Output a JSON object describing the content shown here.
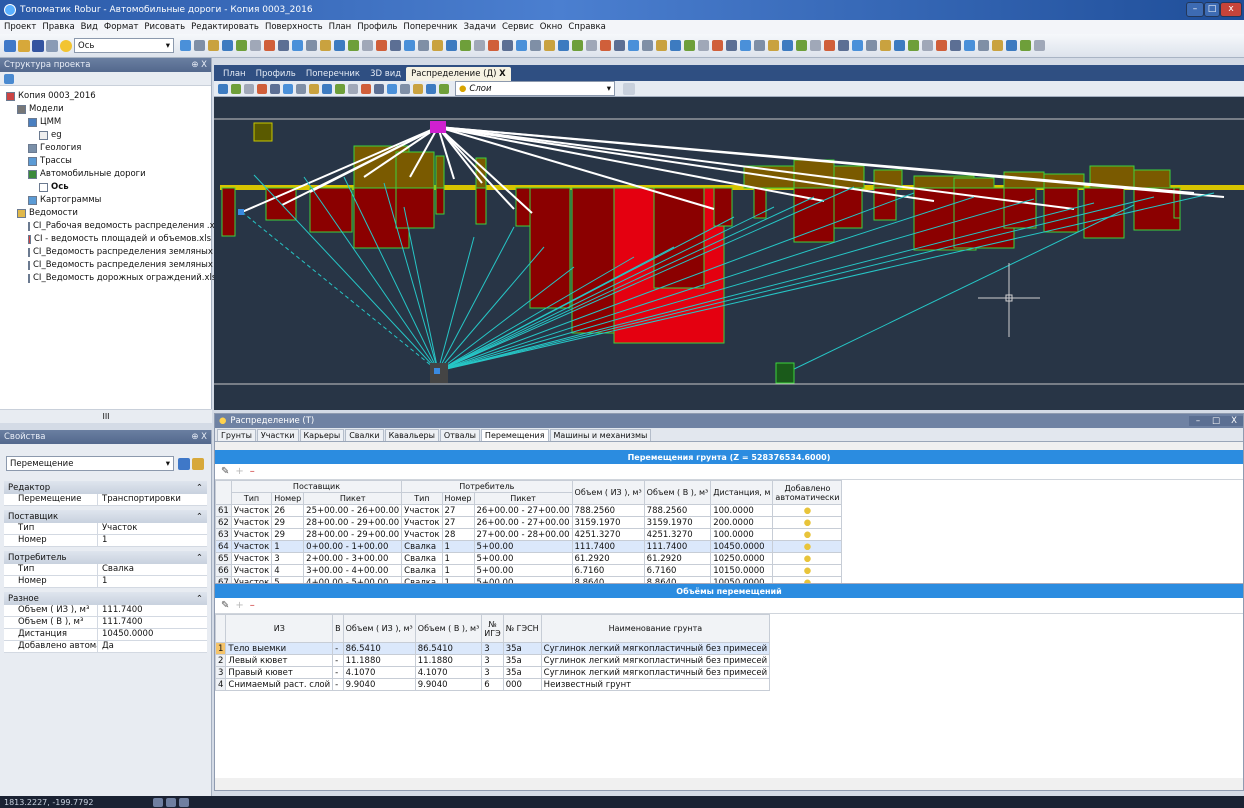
{
  "app": {
    "title": "Топоматик Robur - Автомобильные дороги - Копия 0003_2016",
    "status_coords": "1813.2227, -199.7792"
  },
  "menu": [
    "Проект",
    "Правка",
    "Вид",
    "Формат",
    "Рисовать",
    "Редактировать",
    "Поверхность",
    "План",
    "Профиль",
    "Поперечник",
    "Задачи",
    "Сервис",
    "Окно",
    "Справка"
  ],
  "toolbar": {
    "combo_value": "Ось",
    "cad_combo_value": "Слои"
  },
  "structure": {
    "header": "Структура проекта",
    "items": [
      {
        "label": "Копия 0003_2016",
        "level": 0
      },
      {
        "label": "Модели",
        "level": 1
      },
      {
        "label": "ЦММ",
        "level": 2
      },
      {
        "label": "eg",
        "level": 3
      },
      {
        "label": "Геология",
        "level": 2
      },
      {
        "label": "Трассы",
        "level": 2
      },
      {
        "label": "Автомобильные дороги",
        "level": 2
      },
      {
        "label": "Ось",
        "level": 3
      },
      {
        "label": "Картограммы",
        "level": 2
      },
      {
        "label": "Ведомости",
        "level": 1
      },
      {
        "label": "CI_Рабочая ведомость распределения .xls",
        "level": 2
      },
      {
        "label": "CI - ведомость площадей и объемов.xls",
        "level": 2
      },
      {
        "label": "CI_Ведомость распределения земляных м",
        "level": 2
      },
      {
        "label": "CI_Ведомость распределения земляных м",
        "level": 2
      },
      {
        "label": "CI_Ведомость дорожных ограждений.xls",
        "level": 2
      }
    ],
    "scroll_label": "III"
  },
  "properties": {
    "header": "Свойства",
    "selector": "Перемещение",
    "groups": [
      {
        "title": "Редактор",
        "rows": [
          {
            "k": "Перемещение",
            "v": "Транспортировки"
          }
        ]
      },
      {
        "title": "Поставщик",
        "rows": [
          {
            "k": "Тип",
            "v": "Участок"
          },
          {
            "k": "Номер",
            "v": "1"
          }
        ]
      },
      {
        "title": "Потребитель",
        "rows": [
          {
            "k": "Тип",
            "v": "Свалка"
          },
          {
            "k": "Номер",
            "v": "1"
          }
        ]
      },
      {
        "title": "Разное",
        "rows": [
          {
            "k": "Объем ( ИЗ ), м³",
            "v": "111.7400"
          },
          {
            "k": "Объем ( В ), м³",
            "v": "111.7400"
          },
          {
            "k": "Дистанция",
            "v": "10450.0000"
          },
          {
            "k": "Добавлено автомати...",
            "v": "Да"
          }
        ]
      }
    ]
  },
  "doc_tabs": [
    "План",
    "Профиль",
    "Поперечник",
    "3D вид",
    "Распределение (Д)"
  ],
  "close_glyph": "X",
  "dist_window": {
    "title": "Распределение (Т)",
    "tabs": [
      "Грунты",
      "Участки",
      "Карьеры",
      "Свалки",
      "Кавальеры",
      "Отвалы",
      "Перемещения",
      "Машины и механизмы"
    ],
    "moves_title": "Перемещения грунта (Z = 528376534.6000)",
    "moves_headers": {
      "supplier": "Поставщик",
      "consumer": "Потребитель",
      "type": "Тип",
      "number": "Номер",
      "picket": "Пикет",
      "vol_from": "Объем ( ИЗ ), м³",
      "vol_to": "Объем ( В ), м³",
      "distance": "Дистанция, м",
      "auto": "Добавлено автоматически"
    },
    "moves_rows": [
      {
        "n": "61",
        "t1": "Участок",
        "n1": "26",
        "p1": "25+00.00 - 26+00.00",
        "t2": "Участок",
        "n2": "27",
        "p2": "26+00.00 - 27+00.00",
        "v1": "788.2560",
        "v2": "788.2560",
        "d": "100.0000"
      },
      {
        "n": "62",
        "t1": "Участок",
        "n1": "29",
        "p1": "28+00.00 - 29+00.00",
        "t2": "Участок",
        "n2": "27",
        "p2": "26+00.00 - 27+00.00",
        "v1": "3159.1970",
        "v2": "3159.1970",
        "d": "200.0000"
      },
      {
        "n": "63",
        "t1": "Участок",
        "n1": "29",
        "p1": "28+00.00 - 29+00.00",
        "t2": "Участок",
        "n2": "28",
        "p2": "27+00.00 - 28+00.00",
        "v1": "4251.3270",
        "v2": "4251.3270",
        "d": "100.0000"
      },
      {
        "n": "64",
        "t1": "Участок",
        "n1": "1",
        "p1": "0+00.00 - 1+00.00",
        "t2": "Свалка",
        "n2": "1",
        "p2": "5+00.00",
        "v1": "111.7400",
        "v2": "111.7400",
        "d": "10450.0000"
      },
      {
        "n": "65",
        "t1": "Участок",
        "n1": "3",
        "p1": "2+00.00 - 3+00.00",
        "t2": "Свалка",
        "n2": "1",
        "p2": "5+00.00",
        "v1": "61.2920",
        "v2": "61.2920",
        "d": "10250.0000"
      },
      {
        "n": "66",
        "t1": "Участок",
        "n1": "4",
        "p1": "3+00.00 - 4+00.00",
        "t2": "Свалка",
        "n2": "1",
        "p2": "5+00.00",
        "v1": "6.7160",
        "v2": "6.7160",
        "d": "10150.0000"
      },
      {
        "n": "67",
        "t1": "Участок",
        "n1": "5",
        "p1": "4+00.00 - 5+00.00",
        "t2": "Свалка",
        "n2": "1",
        "p2": "5+00.00",
        "v1": "8.8640",
        "v2": "8.8640",
        "d": "10050.0000"
      }
    ],
    "volumes_title": "Объёмы перемещений",
    "vol_headers": {
      "iz": "ИЗ",
      "v": "В",
      "vol_from": "Объем ( ИЗ ), м³",
      "vol_to": "Объем ( В ), м³",
      "igz": "№ ИГЭ",
      "gesn": "№ ГЭСН",
      "soil": "Наименование грунта"
    },
    "vol_rows": [
      {
        "n": "1",
        "iz": "Тело выемки",
        "b": "-",
        "v1": "86.5410",
        "v2": "86.5410",
        "igz": "3",
        "gesn": "35а",
        "soil": "Суглинок легкий мягкопластичный без примесей"
      },
      {
        "n": "2",
        "iz": "Левый кювет",
        "b": "-",
        "v1": "11.1880",
        "v2": "11.1880",
        "igz": "3",
        "gesn": "35а",
        "soil": "Суглинок легкий мягкопластичный без примесей"
      },
      {
        "n": "3",
        "iz": "Правый кювет",
        "b": "-",
        "v1": "4.1070",
        "v2": "4.1070",
        "igz": "3",
        "gesn": "35а",
        "soil": "Суглинок легкий мягкопластичный без примесей"
      },
      {
        "n": "4",
        "iz": "Снимаемый раст. слой",
        "b": "-",
        "v1": "9.9040",
        "v2": "9.9040",
        "igz": "6",
        "gesn": "000",
        "soil": "Неизвестный грунт"
      }
    ]
  },
  "colors": {
    "cad_bg": "#283546",
    "fill": "#8b0000",
    "fill_light": "#e40010",
    "embank": "#7a5a00",
    "green": "#3cd23c",
    "white": "#ffffff",
    "cyan": "#26c6c6",
    "magenta": "#d020d0"
  }
}
